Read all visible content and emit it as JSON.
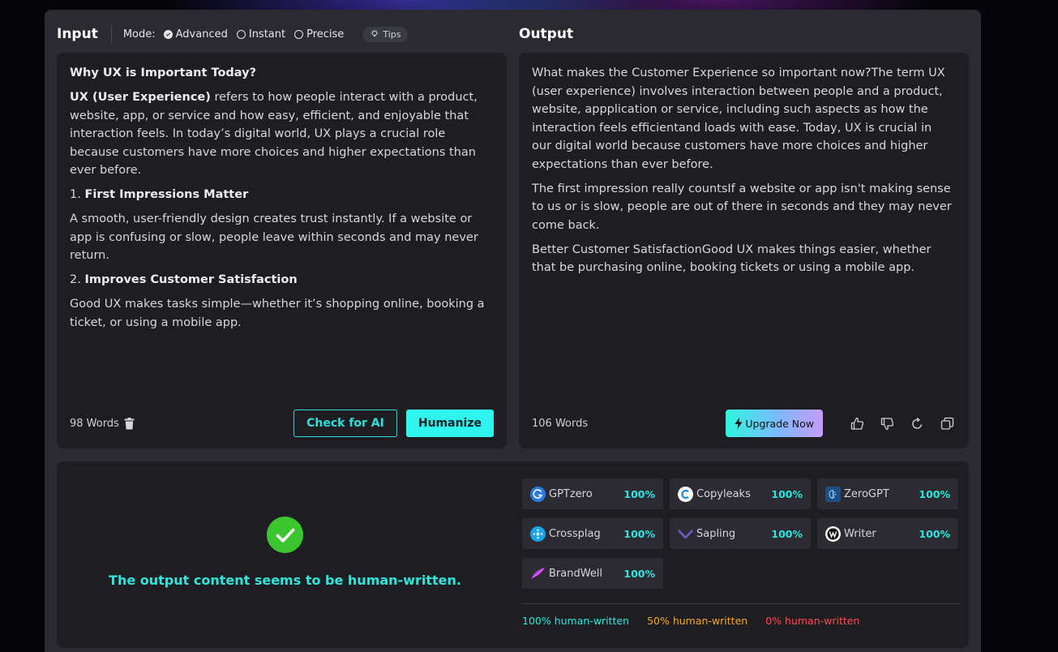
{
  "colors": {
    "accent_cyan": "#2ff5ee",
    "success_green": "#3bc52e",
    "legend_100": "#2fe6dc",
    "legend_50": "#f5a623",
    "legend_0": "#ff4d4d"
  },
  "header": {
    "input_title": "Input",
    "mode_label": "Mode:",
    "modes": [
      {
        "label": "Advanced",
        "selected": true
      },
      {
        "label": "Instant",
        "selected": false
      },
      {
        "label": "Precise",
        "selected": false
      }
    ],
    "tips_label": "Tips",
    "tips_icon": "lightbulb-icon",
    "output_title": "Output"
  },
  "input": {
    "heading": "Why UX is Important Today?",
    "p1_bold": "UX (User Experience)",
    "p1_rest": " refers to how people interact with a product, website, app, or service and how easy, efficient, and enjoyable that interaction feels. In today’s digital world, UX plays a crucial role because customers have more choices and higher expectations than ever before.",
    "s1_num": "1. ",
    "s1_title": "First Impressions Matter",
    "s1_body": "A smooth, user-friendly design creates trust instantly. If a website or app is confusing or slow, people leave within seconds and may never return.",
    "s2_num": "2. ",
    "s2_title": "Improves Customer Satisfaction",
    "s2_body": "Good UX makes tasks simple—whether it’s shopping online, booking a ticket, or using a mobile app.",
    "word_count": "98 Words",
    "delete_icon": "trash-icon",
    "check_button": "Check for AI",
    "humanize_button": "Humanize"
  },
  "output": {
    "p1": "What makes the Customer Experience so important now?The term UX (user experience) involves interaction between people and a product, website, appplication or service, including such aspects as how the interaction feels efficientand loads with ease. Today, UX is crucial in our digital world because customers have more choices and higher expectations than ever before.",
    "p2": "The first impression really countsIf a website or app isn't making sense to us or is slow, people are out of there in seconds and they may never come back.",
    "p3": "Better Customer SatisfactionGood UX makes things easier, whether that be purchasing online, booking tickets or using a mobile app.",
    "word_count": "106 Words",
    "upgrade_button": "Upgrade Now",
    "upgrade_icon": "lightning-icon",
    "actions": [
      "thumbs-up-icon",
      "thumbs-down-icon",
      "regenerate-icon",
      "copy-icon"
    ]
  },
  "results": {
    "verdict_icon": "check-circle-icon",
    "verdict_text": "The output content seems to be human-written.",
    "detectors": [
      {
        "name": "GPTzero",
        "score": "100%",
        "icon": "gptzero-logo"
      },
      {
        "name": "Copyleaks",
        "score": "100%",
        "icon": "copyleaks-logo"
      },
      {
        "name": "ZeroGPT",
        "score": "100%",
        "icon": "zerogpt-logo"
      },
      {
        "name": "Crossplag",
        "score": "100%",
        "icon": "crossplag-logo"
      },
      {
        "name": "Sapling",
        "score": "100%",
        "icon": "sapling-logo"
      },
      {
        "name": "Writer",
        "score": "100%",
        "icon": "writer-logo"
      },
      {
        "name": "BrandWell",
        "score": "100%",
        "icon": "brandwell-logo"
      }
    ],
    "legend": [
      "100% human-written",
      "50% human-written",
      "0% human-written"
    ]
  }
}
